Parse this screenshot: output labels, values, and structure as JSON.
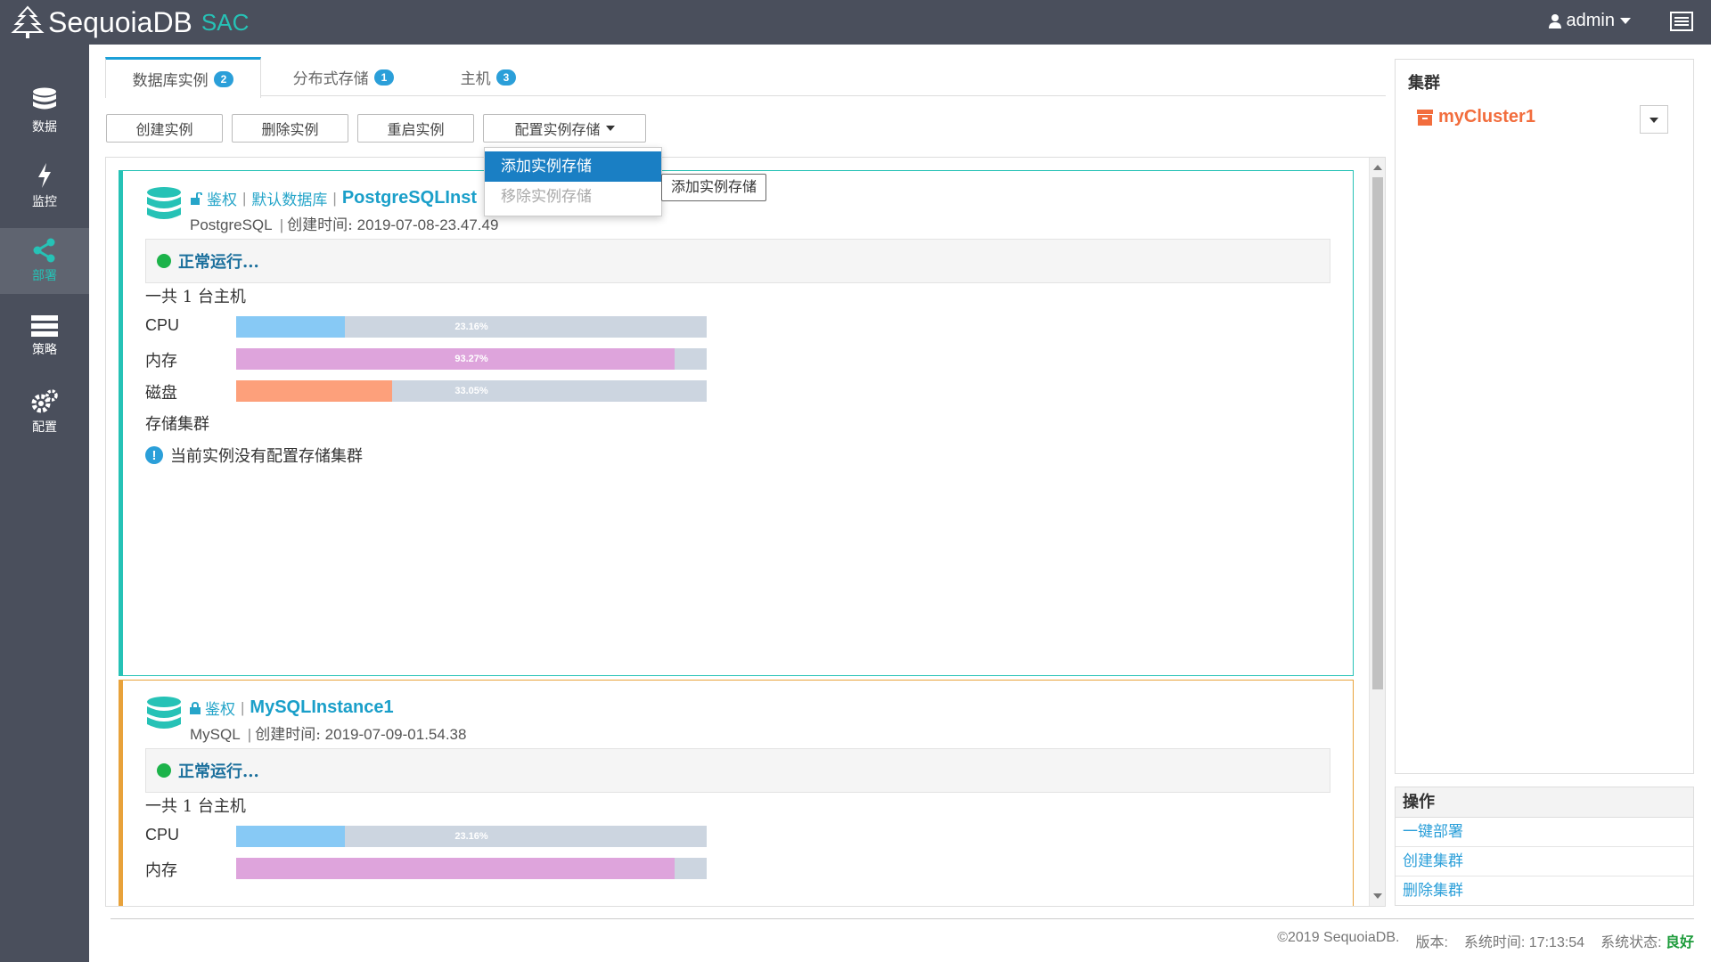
{
  "app": {
    "name": "SequoiaDB",
    "suffix": "SAC",
    "user": "admin"
  },
  "sidebar": {
    "items": [
      {
        "label": "数据",
        "icon": "database-icon"
      },
      {
        "label": "监控",
        "icon": "lightning-icon"
      },
      {
        "label": "部署",
        "icon": "share-icon"
      },
      {
        "label": "策略",
        "icon": "server-icon"
      },
      {
        "label": "配置",
        "icon": "gears-icon"
      }
    ],
    "active": "部署"
  },
  "tabs": [
    {
      "label": "数据库实例",
      "count": "2"
    },
    {
      "label": "分布式存储",
      "count": "1"
    },
    {
      "label": "主机",
      "count": "3"
    }
  ],
  "toolbar": {
    "create": "创建实例",
    "delete": "删除实例",
    "restart": "重启实例",
    "config": "配置实例存储"
  },
  "dropdown": {
    "add": "添加实例存储",
    "remove": "移除实例存储",
    "tooltip": "添加实例存储"
  },
  "instances": [
    {
      "auth": "鉴权",
      "default_db": "默认数据库",
      "name": "PostgreSQLInst",
      "type": "PostgreSQL",
      "created_label": "创建时间:",
      "created": "2019-07-08-23.47.49",
      "status": "正常运行...",
      "hosts": "一共 1 台主机",
      "cpu_label": "CPU",
      "cpu": "23.16%",
      "cpu_fraction": 0.2316,
      "mem_label": "内存",
      "mem": "93.27%",
      "mem_fraction": 0.9327,
      "disk_label": "磁盘",
      "disk": "33.05%",
      "disk_fraction": 0.3305,
      "storage_label": "存储集群",
      "storage_notice": "当前实例没有配置存储集群"
    },
    {
      "auth": "鉴权",
      "name": "MySQLInstance1",
      "type": "MySQL",
      "created_label": "创建时间:",
      "created": "2019-07-09-01.54.38",
      "status": "正常运行...",
      "hosts": "一共 1 台主机",
      "cpu_label": "CPU",
      "cpu": "23.16%",
      "cpu_fraction": 0.2316,
      "mem_label": "内存",
      "mem_fraction": 0.9327
    }
  ],
  "cluster": {
    "title": "集群",
    "name": "myCluster1"
  },
  "operations": {
    "title": "操作",
    "items": [
      "一键部署",
      "创建集群",
      "删除集群"
    ]
  },
  "footer": {
    "copyright": "©2019 SequoiaDB.",
    "version_label": "版本:",
    "time_label": "系统时间:",
    "time": "17:13:54",
    "status_label": "系统状态:",
    "status": "良好"
  },
  "colors": {
    "accent": "#26c2b6",
    "cpu": "#87c9f5",
    "mem": "#dea4dc",
    "disk": "#fda07b",
    "pg_border": "#26c2b6",
    "mysql_border": "#e8a23b",
    "cluster": "#f26d3d"
  }
}
